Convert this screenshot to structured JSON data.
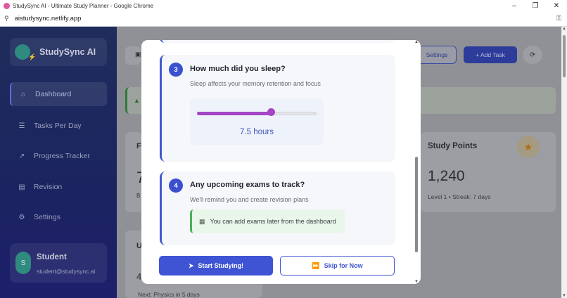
{
  "browser": {
    "window_title": "StudySync AI - Ultimate Study Planner - Google Chrome",
    "url": "aistudysync.netlify.app",
    "controls": {
      "minimize": "–",
      "restore": "❐",
      "close": "✕"
    }
  },
  "sidebar": {
    "brand": "StudySync AI",
    "items": [
      {
        "label": "Dashboard",
        "icon": "home-icon",
        "glyph": "⌂",
        "active": true
      },
      {
        "label": "Tasks Per Day",
        "icon": "list-icon",
        "glyph": "☰"
      },
      {
        "label": "Progress Tracker",
        "icon": "chart-icon",
        "glyph": "↗"
      },
      {
        "label": "Revision",
        "icon": "book-icon",
        "glyph": "▤"
      },
      {
        "label": "Settings",
        "icon": "gear-icon",
        "glyph": "⚙"
      }
    ],
    "user": {
      "initial": "S",
      "name": "Student",
      "email": "student@studysync.ai"
    }
  },
  "dashboard_bg": {
    "settings_label": "Settings",
    "add_task_label": "+ Add Task",
    "study_points_title": "Study Points",
    "study_points_value": "1,240",
    "study_points_meta": "Level 1 • Streak: 7 days",
    "partial_left_letter": "F",
    "partial_left_digit": "7",
    "partial_left_small": "B",
    "partial_bottom_letter": "U",
    "partial_bottom_digit": "4",
    "next_exam_text": "Next: Physics in 5 days"
  },
  "modal": {
    "step3": {
      "number": "3",
      "title": "How much did you sleep?",
      "subtitle": "Sleep affects your memory retention and focus",
      "sleep_value_text": "7.5 hours",
      "slider_fraction": 0.62
    },
    "step4": {
      "number": "4",
      "title": "Any upcoming exams to track?",
      "subtitle": "We'll remind you and create revision plans",
      "note": "You can add exams later from the dashboard"
    },
    "start_button": "Start Studying!",
    "skip_button": "Skip for Now"
  },
  "colors": {
    "accent": "#3f54d4",
    "slider": "#a445c4",
    "success": "#4caf57"
  }
}
